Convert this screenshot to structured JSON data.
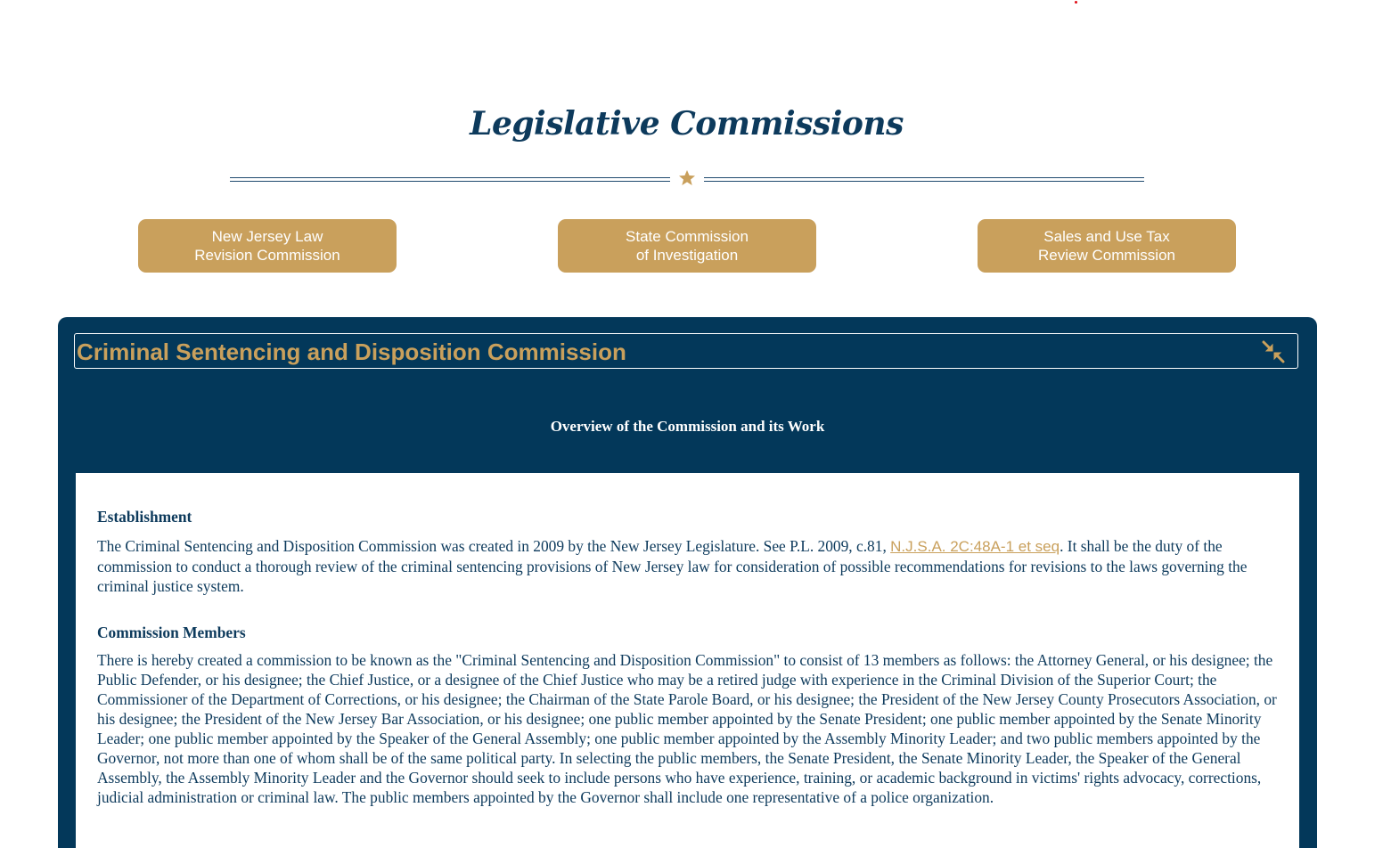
{
  "page": {
    "title": "Legislative Commissions"
  },
  "commissions": [
    {
      "line1": "New Jersey Law",
      "line2": "Revision Commission"
    },
    {
      "line1": "State Commission",
      "line2": "of Investigation"
    },
    {
      "line1": "Sales and Use Tax",
      "line2": "Review Commission"
    }
  ],
  "panel": {
    "heading": "Criminal Sentencing and Disposition Commission",
    "overview": "Overview of the Commission and its Work",
    "sections": [
      {
        "title": "Establishment",
        "text_before": "The Criminal Sentencing and Disposition Commission was created in 2009 by the New Jersey Legislature. See P.L. 2009, c.81, ",
        "link": "N.J.S.A. 2C:48A-1 et seq",
        "text_after": ". It shall be the duty of the commission to conduct a thorough review of the criminal sentencing provisions of New Jersey law for consideration of possible recommendations for revisions to the laws governing the criminal justice system."
      },
      {
        "title": "Commission Members",
        "text": "There is hereby created a commission to be known as the \"Criminal Sentencing and Disposition Commission\" to consist of 13 members as follows: the Attorney General, or his designee; the Public Defender, or his designee; the Chief Justice, or a designee of the Chief Justice who may be a retired judge with experience in the Criminal Division of the Superior Court; the Commissioner of the Department of Corrections, or his designee; the Chairman of the State Parole Board, or his designee; the President of the New Jersey County Prosecutors Association, or his designee; the President of the New Jersey Bar Association, or his designee; one public member appointed by the Senate President; one public member appointed by the Senate Minority Leader; one public member appointed by the Speaker of the General Assembly; one public member appointed by the Assembly Minority Leader; and two public members appointed by the Governor, not more than one of whom shall be of the same political party. In selecting the public members, the Senate President, the Senate Minority Leader, the Speaker of the General Assembly, the Assembly Minority Leader and the Governor should seek to include persons who have experience, training, or academic background in victims' rights advocacy, corrections, judicial administration or criminal law. The public members appointed by the Governor shall include one representative of a police organization."
      }
    ]
  },
  "icons": {
    "divider": "star-icon",
    "collapse": "collapse-arrows-icon"
  },
  "colors": {
    "navy": "#03385a",
    "gold": "#c9a05c",
    "title": "#0d3a5c"
  }
}
